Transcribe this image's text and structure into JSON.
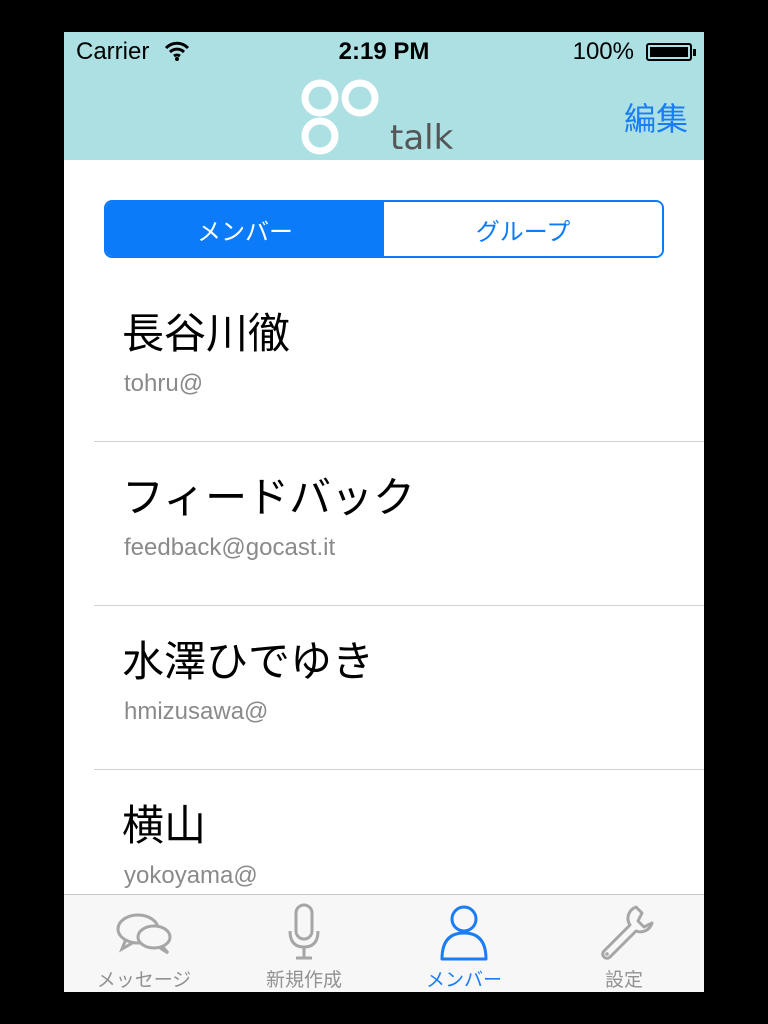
{
  "status_bar": {
    "carrier": "Carrier",
    "time": "2:19 PM",
    "battery_percent": "100%",
    "battery_level": 1.0
  },
  "nav": {
    "logo_text": "talk",
    "logo_mark": "go",
    "edit_label": "編集",
    "accent_color": "#1a7df6",
    "bar_color": "#ace0e3"
  },
  "segment": {
    "members_label": "メンバー",
    "groups_label": "グループ",
    "selected": "members"
  },
  "members": [
    {
      "name": "長谷川徹",
      "email": "tohru@"
    },
    {
      "name": "フィードバック",
      "email": "feedback@gocast.it"
    },
    {
      "name": "水澤ひでゆき",
      "email": "hmizusawa@"
    },
    {
      "name": "横山",
      "email": "yokoyama@"
    }
  ],
  "tabbar": {
    "tabs": [
      {
        "label": "メッセージ",
        "icon": "chat-bubbles-icon"
      },
      {
        "label": "新規作成",
        "icon": "microphone-icon"
      },
      {
        "label": "メンバー",
        "icon": "person-icon",
        "active": true
      },
      {
        "label": "設定",
        "icon": "wrench-icon"
      }
    ]
  }
}
